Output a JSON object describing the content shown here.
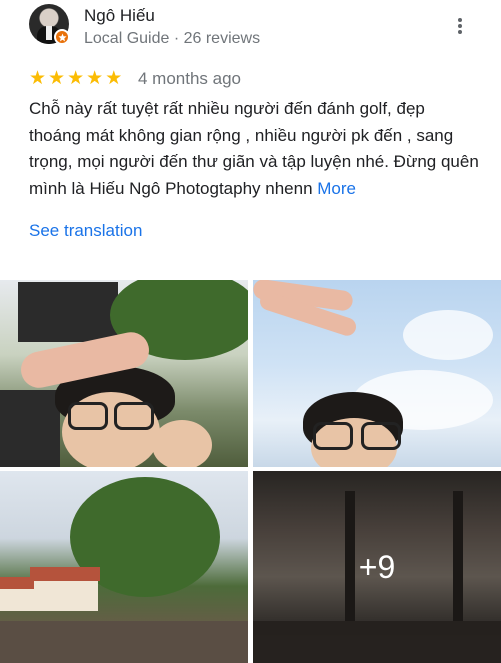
{
  "reviewer": {
    "name": "Ngô Hiếu",
    "meta": "Local Guide · 26 reviews"
  },
  "rating": {
    "stars": 5,
    "time": "4 months ago"
  },
  "review": {
    "text": "Chỗ này rất tuyệt rất nhiều người đến đánh golf, đẹp thoáng mát không gian rộng , nhiều người pk đến , sang trọng, mọi người đến thư giãn và tập luyện nhé. Đừng quên mình là Hiếu Ngô Photogtaphy nhenn",
    "more_label": "More"
  },
  "translate_label": "See translation",
  "photos": {
    "extra_count": "+9"
  },
  "colors": {
    "star": "#fbbc04",
    "link": "#1a73e8",
    "badge": "#e8710a"
  },
  "icons": [
    "local-guide-badge-icon",
    "star-icon",
    "more-vert-icon"
  ]
}
